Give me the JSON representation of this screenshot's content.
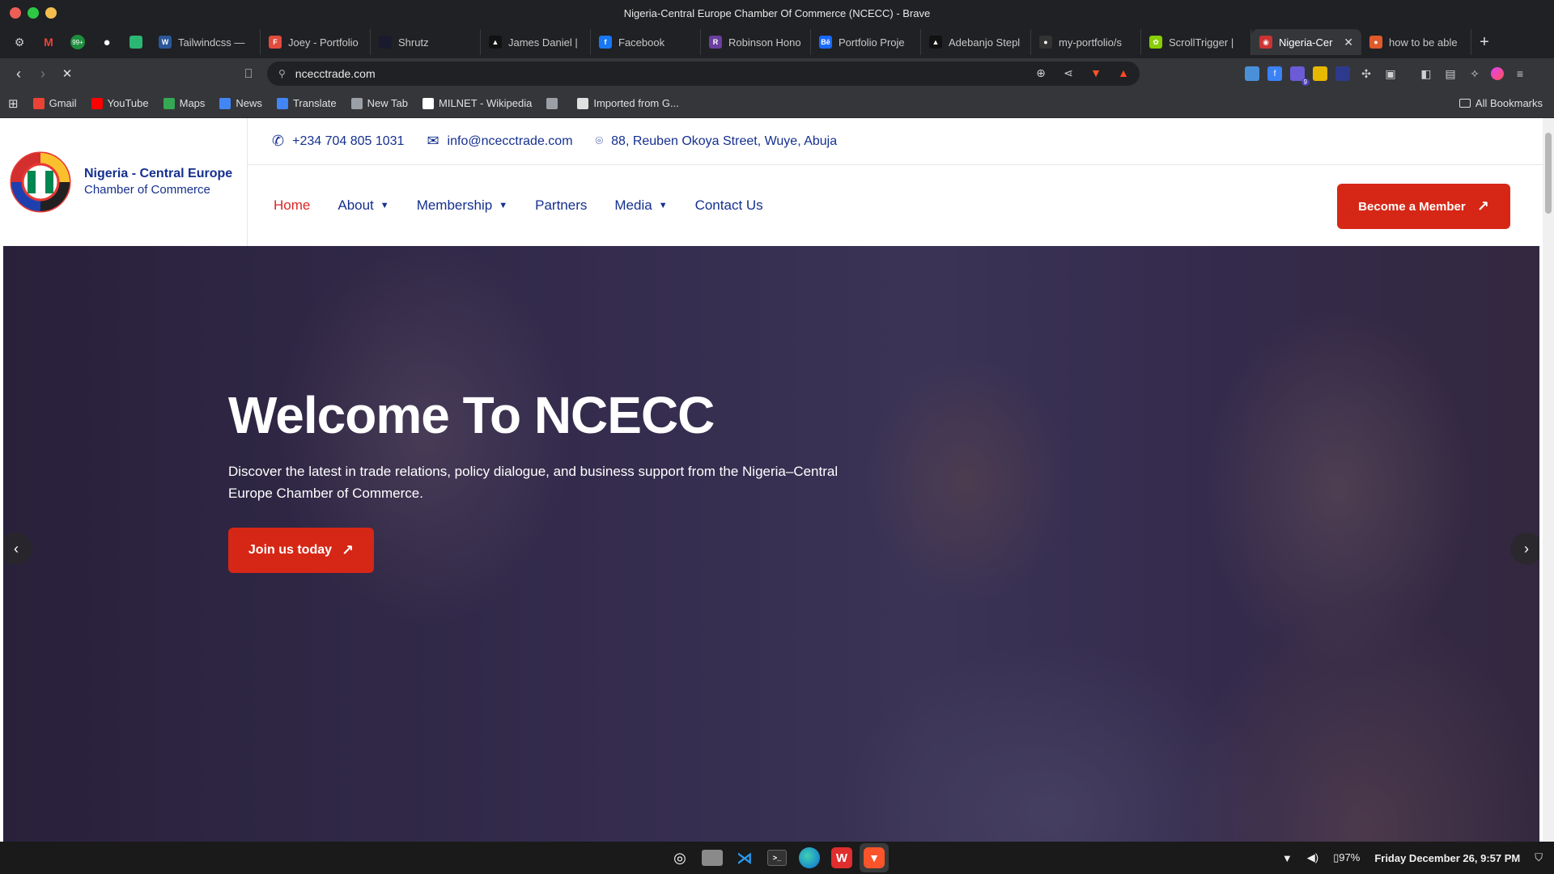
{
  "window": {
    "title": "Nigeria-Central Europe Chamber Of Commerce (NCECC) - Brave"
  },
  "tabs": [
    {
      "label": "Tailwindcss — ",
      "color": "#2b579a",
      "glyph": "W"
    },
    {
      "label": "Joey - Portfolio",
      "color": "#e24c3d",
      "glyph": "F"
    },
    {
      "label": "Shrutz",
      "color": "#1a1a2e",
      "glyph": ""
    },
    {
      "label": "James Daniel |",
      "color": "#111111",
      "glyph": "▲"
    },
    {
      "label": "Facebook",
      "color": "#1877f2",
      "glyph": "f"
    },
    {
      "label": "Robinson Hono",
      "color": "#6b3fa0",
      "glyph": "R"
    },
    {
      "label": "Portfolio Proje",
      "color": "#1769ff",
      "glyph": "Bē"
    },
    {
      "label": "Adebanjo Stepl",
      "color": "#111111",
      "glyph": "▲"
    },
    {
      "label": "my-portfolio/s",
      "color": "#333333",
      "glyph": "●"
    },
    {
      "label": "ScrollTrigger |",
      "color": "#88ce02",
      "glyph": "✿"
    },
    {
      "label": "Nigeria-Cer",
      "color": "#cc3333",
      "glyph": "◉",
      "active": true
    },
    {
      "label": "how to be able",
      "color": "#e05a2b",
      "glyph": "●"
    }
  ],
  "toolbar": {
    "url": "ncecctrade.com"
  },
  "extensions": {
    "badge_count": "9"
  },
  "bookmarks": {
    "items": [
      {
        "label": "Gmail",
        "color": "#ea4335"
      },
      {
        "label": "YouTube",
        "color": "#ff0000"
      },
      {
        "label": "Maps",
        "color": "#34a853"
      },
      {
        "label": "News",
        "color": "#4285f4"
      },
      {
        "label": "Translate",
        "color": "#4285f4"
      },
      {
        "label": "New Tab",
        "color": "#9aa0a6"
      },
      {
        "label": "MILNET - Wikipedia",
        "color": "#ffffff"
      },
      {
        "label": "",
        "color": "#9aa0a6"
      },
      {
        "label": "Imported from G...",
        "color": "#e0e0e0"
      }
    ],
    "all_bookmarks": "All Bookmarks"
  },
  "site": {
    "logo_line1": "Nigeria - Central Europe",
    "logo_line2": "Chamber of Commerce",
    "phone": "+234 704 805 1031",
    "email": "info@ncecctrade.com",
    "address": "88, Reuben Okoya Street, Wuye, Abuja",
    "nav": [
      "Home",
      "About",
      "Membership",
      "Partners",
      "Media",
      "Contact Us"
    ],
    "cta": "Become a Member",
    "accent": "#d62716",
    "brand": "#15308f"
  },
  "hero": {
    "title": "Welcome To NCECC",
    "description": "Discover the latest in trade relations, policy dialogue, and business support from the Nigeria–Central Europe Chamber of Commerce.",
    "button": "Join us today"
  },
  "taskbar": {
    "battery": "97%",
    "datetime": "Friday December 26, 9:57 PM"
  }
}
